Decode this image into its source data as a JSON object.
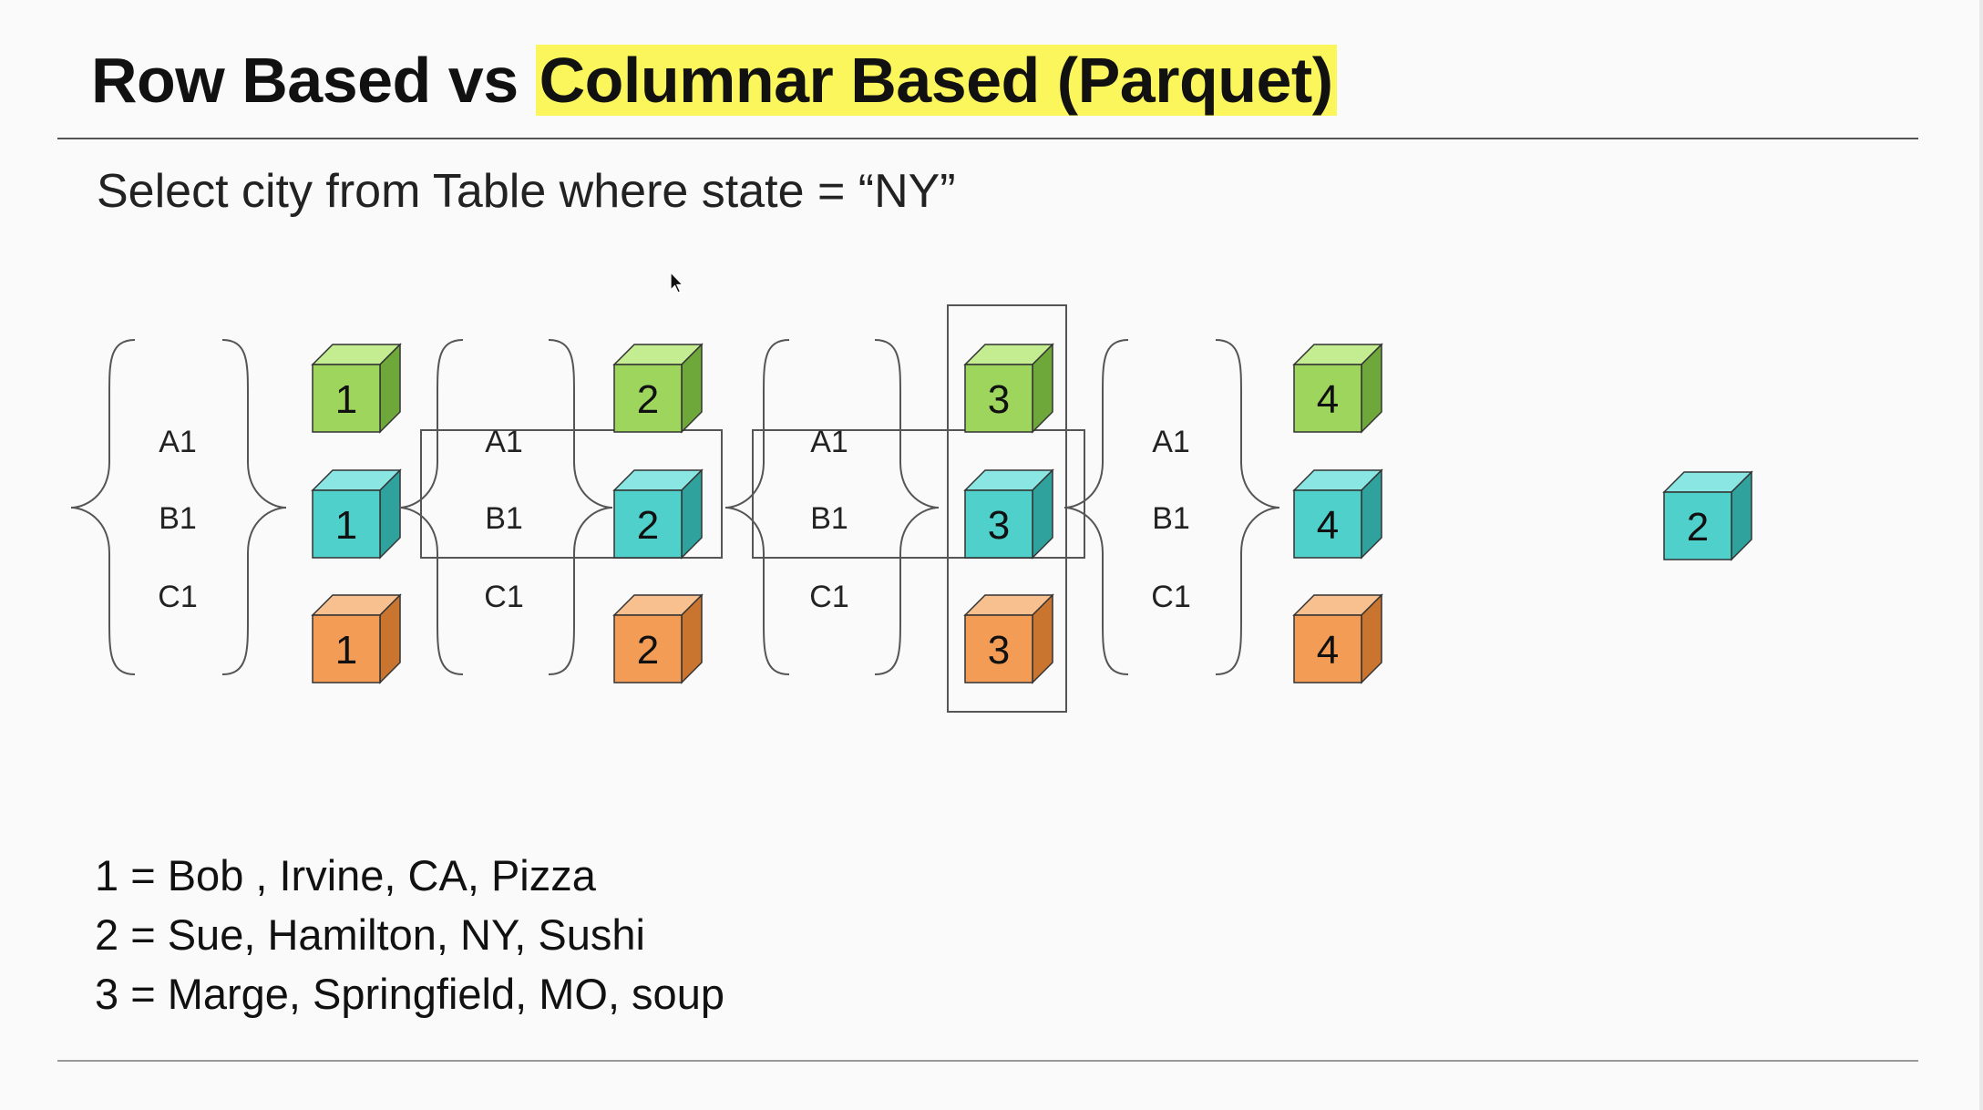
{
  "slide": {
    "title_prefix": "Row Based vs ",
    "title_highlight": "Columnar Based (Parquet)",
    "query": "Select city from Table where state = “NY”"
  },
  "groups": [
    {
      "labels": [
        "A1",
        "B1",
        "C1"
      ],
      "cubes": [
        "1",
        "1",
        "1"
      ]
    },
    {
      "labels": [
        "A1",
        "B1",
        "C1"
      ],
      "cubes": [
        "2",
        "2",
        "2"
      ]
    },
    {
      "labels": [
        "A1",
        "B1",
        "C1"
      ],
      "cubes": [
        "3",
        "3",
        "3"
      ]
    },
    {
      "labels": [
        "A1",
        "B1",
        "C1"
      ],
      "cubes": [
        "4",
        "4",
        "4"
      ]
    }
  ],
  "result_cube": "2",
  "colors": {
    "row1": {
      "front": "#9ed65d",
      "top": "#c4ec91",
      "side": "#6fa83a"
    },
    "row2": {
      "front": "#4fd0cb",
      "top": "#8ae6e2",
      "side": "#2fa29d"
    },
    "row3": {
      "front": "#f29c56",
      "top": "#f8c08e",
      "side": "#c97530"
    },
    "title_highlight": "#fbf65c"
  },
  "legend": [
    "1 = Bob , Irvine, CA, Pizza",
    "2 = Sue, Hamilton, NY, Sushi",
    "3 = Marge, Springfield, MO, soup"
  ]
}
